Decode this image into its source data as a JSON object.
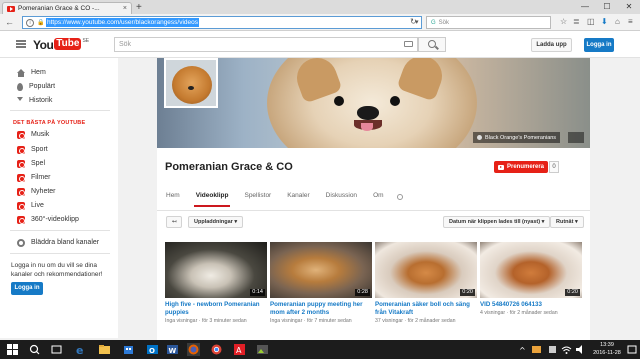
{
  "browser": {
    "tab_title": "Pomeranian Grace & CO -...",
    "tab_close": "×",
    "new_tab": "+",
    "url": "https://www.youtube.com/user/blackorangess/videos",
    "search_placeholder": "Sök",
    "window_controls": [
      "—",
      "☐",
      "✕"
    ]
  },
  "youtube": {
    "logo_you": "You",
    "logo_tube": "Tube",
    "logo_region": "SE",
    "search_placeholder": "Sök",
    "upload_label": "Ladda upp",
    "login_label": "Logga in"
  },
  "sidebar": {
    "main_items": [
      {
        "label": "Hem",
        "icon": "home-icon"
      },
      {
        "label": "Populärt",
        "icon": "trending-icon"
      },
      {
        "label": "Historik",
        "icon": "history-icon"
      }
    ],
    "section_title": "DET BÄSTA PÅ YOUTUBE",
    "best_items": [
      {
        "label": "Musik",
        "icon": "music-icon"
      },
      {
        "label": "Sport",
        "icon": "sport-icon"
      },
      {
        "label": "Spel",
        "icon": "games-icon"
      },
      {
        "label": "Filmer",
        "icon": "movies-icon"
      },
      {
        "label": "Nyheter",
        "icon": "news-icon"
      },
      {
        "label": "Live",
        "icon": "live-icon"
      },
      {
        "label": "360°-videoklipp",
        "icon": "360-icon"
      }
    ],
    "browse_label": "Bläddra bland kanaler",
    "signin_text": "Logga in nu om du vill se dina kanaler och rekommendationer!",
    "signin_button": "Logga in"
  },
  "channel": {
    "banner_link": "Black Orange's Pomeranians",
    "title": "Pomeranian Grace & CO",
    "subscribe_label": "Prenumerera",
    "subscriber_count": "0",
    "tabs": [
      "Hem",
      "Videoklipp",
      "Spellistor",
      "Kanaler",
      "Diskussion",
      "Om"
    ],
    "active_tab": "Videoklipp"
  },
  "controls": {
    "back": "↤",
    "uploads": "Uppladdningar ▾",
    "sort": "Datum när klippen lades till (nyast) ▾",
    "grid": "Rutnät ▾"
  },
  "videos": [
    {
      "title": "High five - newborn Pomeranian puppies",
      "views": "Inga visningar",
      "age": "för 3 minuter sedan",
      "duration": "0:14"
    },
    {
      "title": "Pomeranian puppy meeting her mom after 2 months",
      "views": "Inga visningar",
      "age": "för 7 minuter sedan",
      "duration": "0:28"
    },
    {
      "title": "Pomeranian säker boll och säng från Vitakraft",
      "views": "37 visningar",
      "age": "för 2 månader sedan",
      "duration": "0:20"
    },
    {
      "title": "VID 54840726 064133",
      "views": "4 visningar",
      "age": "för 2 månader sedan",
      "duration": "0:20"
    }
  ],
  "taskbar": {
    "time": "13:39",
    "date": "2016-11-28"
  }
}
